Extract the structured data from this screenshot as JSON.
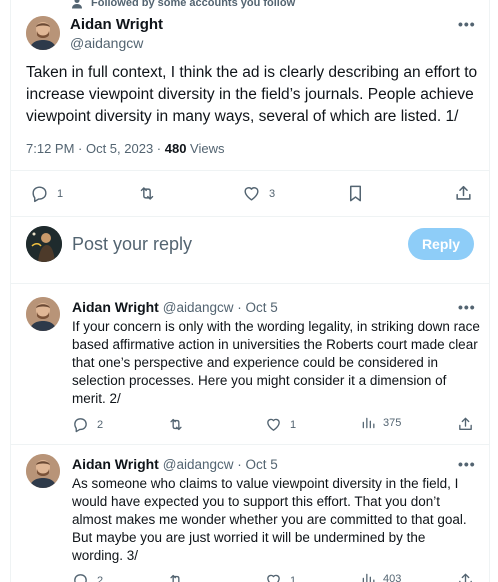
{
  "social_context": {
    "text": "Followed by some accounts you follow",
    "icon": "person-icon"
  },
  "main_tweet": {
    "author_name": "Aidan Wright",
    "author_handle": "@aidangcw",
    "more_label": "•••",
    "text": "Taken in full context, I think the ad is clearly describing an effort to increase viewpoint diversity in the field’s journals. People achieve viewpoint diversity in many ways, several of which are listed. 1/",
    "timestamp": "7:12 PM · Oct 5, 2023 · ",
    "views_count": "480",
    "views_label": " Views",
    "actions": {
      "replies": "1",
      "retweets": "",
      "likes": "3"
    }
  },
  "composer": {
    "placeholder": "Post your reply",
    "reply_button": "Reply"
  },
  "replies": [
    {
      "author_name": "Aidan Wright",
      "author_handle": "@aidangcw · Oct 5",
      "more_label": "•••",
      "text": "If your concern is only with the wording legality, in striking down race based affirmative action in universities the Roberts court made clear that one’s perspective and experience could be considered in selection processes. Here you might consider it a dimension of merit. 2/",
      "actions": {
        "replies": "2",
        "retweets": "",
        "likes": "1",
        "views": "375"
      }
    },
    {
      "author_name": "Aidan Wright",
      "author_handle": "@aidangcw · Oct 5",
      "more_label": "•••",
      "text": "As someone who claims to value viewpoint diversity in the field, I would have expected you to support this effort. That you don’t almost makes me wonder whether you are committed to that goal. But maybe you are just worried it will be undermined by the wording. 3/",
      "actions": {
        "replies": "2",
        "retweets": "",
        "likes": "1",
        "views": "403"
      }
    }
  ],
  "colors": {
    "accent": "#1d9bf0",
    "reply_button_disabled": "#8ecdf8",
    "muted": "#536471",
    "divider": "#eff3f4"
  }
}
